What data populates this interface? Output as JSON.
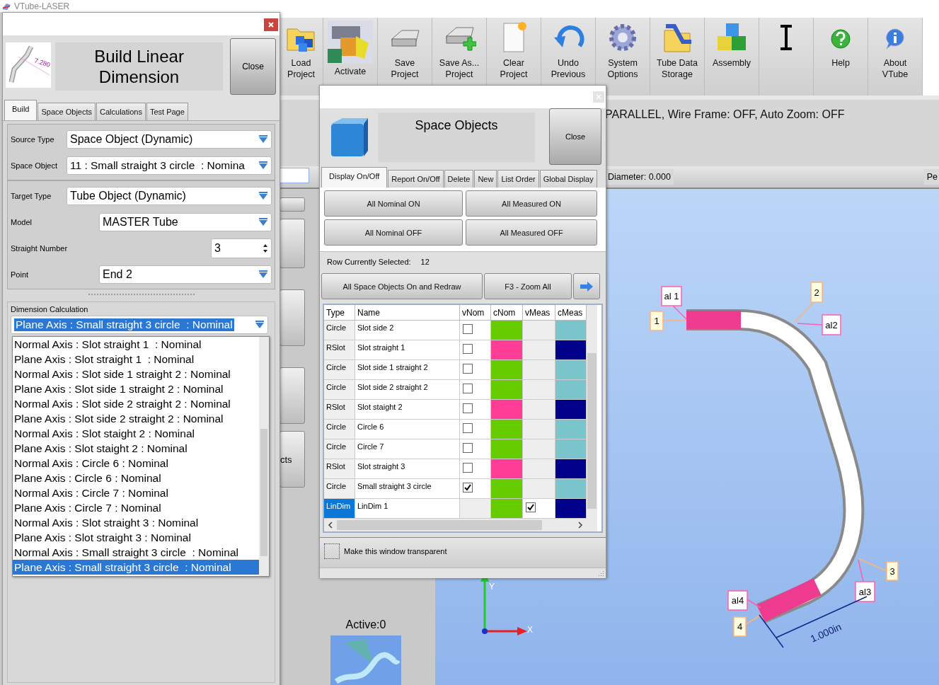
{
  "app": {
    "title": "VTube-LASER"
  },
  "toolbar": [
    {
      "kind": "load",
      "label": "Load Project"
    },
    {
      "kind": "activate",
      "label": "Activate"
    },
    {
      "kind": "save",
      "label": "Save Project"
    },
    {
      "kind": "save_as",
      "label": "Save As... Project"
    },
    {
      "kind": "clear",
      "label": "Clear Project"
    },
    {
      "kind": "undo",
      "label": "Undo Previous"
    },
    {
      "kind": "options",
      "label": "System Options"
    },
    {
      "kind": "storage",
      "label": "Tube Data Storage"
    },
    {
      "kind": "assembly",
      "label": "Assembly"
    },
    {
      "kind": "cursor"
    },
    {
      "kind": "help",
      "label": "Help"
    },
    {
      "kind": "about",
      "label": "About VTube"
    }
  ],
  "status": {
    "view_info": "PARALLEL, Wire Frame: OFF, Auto Zoom: OFF",
    "diameter": "Diameter: 0.000",
    "column_2": "Pe"
  },
  "side_panel": {
    "button_text": "cts",
    "active": "Active:0"
  },
  "viewport": {
    "axis_x": "X",
    "axis_y": "Y",
    "dimension": "1.000in",
    "callouts": [
      {
        "text": "al 1",
        "kind": "alignment"
      },
      {
        "text": "1",
        "kind": "point"
      },
      {
        "text": "2",
        "kind": "point"
      },
      {
        "text": "al2",
        "kind": "alignment"
      },
      {
        "text": "3",
        "kind": "point"
      },
      {
        "text": "al3",
        "kind": "alignment"
      },
      {
        "text": "al4",
        "kind": "alignment"
      },
      {
        "text": "4",
        "kind": "point"
      }
    ]
  },
  "build_dialog": {
    "title": "Build Linear Dimension",
    "icon_text": "7.280",
    "close": "Close",
    "tabs": [
      {
        "label": "Build",
        "selected": true
      },
      {
        "label": "Space Objects",
        "selected": false
      },
      {
        "label": "Calculations",
        "selected": false
      },
      {
        "label": "Test Page",
        "selected": false
      }
    ],
    "source_group": [
      {
        "label": "Source Type",
        "value": "Space Object (Dynamic)",
        "kind": "combo"
      },
      {
        "label": "Space Object",
        "value": "11 : Small straight 3 circle  : Nomina",
        "kind": "combo"
      }
    ],
    "target_group": [
      {
        "label": "Target Type",
        "value": "Tube Object (Dynamic)",
        "kind": "combo"
      },
      {
        "label": "Model",
        "value": "MASTER Tube",
        "kind": "combo"
      },
      {
        "label": "Straight Number",
        "value": "3",
        "kind": "spin"
      },
      {
        "label": "Point",
        "value": "End 2",
        "kind": "combo"
      }
    ],
    "dimension_calculation": {
      "label": "Dimension Calculation",
      "value": "Plane Axis : Small straight 3 circle  : Nominal",
      "options": [
        {
          "text": "Normal Axis : Slot straight 1  : Nominal",
          "selected": false
        },
        {
          "text": "Plane Axis : Slot straight 1  : Nominal",
          "selected": false
        },
        {
          "text": "Normal Axis : Slot side 1 straight 2 : Nominal",
          "selected": false
        },
        {
          "text": "Plane Axis : Slot side 1 straight 2 : Nominal",
          "selected": false
        },
        {
          "text": "Normal Axis : Slot side 2 straight 2 : Nominal",
          "selected": false
        },
        {
          "text": "Plane Axis : Slot side 2 straight 2 : Nominal",
          "selected": false
        },
        {
          "text": "Normal Axis : Slot staight 2 : Nominal",
          "selected": false
        },
        {
          "text": "Plane Axis : Slot staight 2 : Nominal",
          "selected": false
        },
        {
          "text": "Normal Axis : Circle 6 : Nominal",
          "selected": false
        },
        {
          "text": "Plane Axis : Circle 6 : Nominal",
          "selected": false
        },
        {
          "text": "Normal Axis : Circle 7 : Nominal",
          "selected": false
        },
        {
          "text": "Plane Axis : Circle 7 : Nominal",
          "selected": false
        },
        {
          "text": "Normal Axis : Slot straight 3 : Nominal",
          "selected": false
        },
        {
          "text": "Plane Axis : Slot straight 3 : Nominal",
          "selected": false
        },
        {
          "text": "Normal Axis : Small straight 3 circle  : Nominal",
          "selected": false
        },
        {
          "text": "Plane Axis : Small straight 3 circle  : Nominal",
          "selected": true
        }
      ]
    }
  },
  "space_objects": {
    "title": "Space Objects",
    "close": "Close",
    "tabs": [
      {
        "label": "Display On/Off",
        "selected": true
      },
      {
        "label": "Report On/Off",
        "selected": false
      },
      {
        "label": "Delete",
        "selected": false
      },
      {
        "label": "New",
        "selected": false
      },
      {
        "label": "List Order",
        "selected": false
      },
      {
        "label": "Global Display",
        "selected": false
      }
    ],
    "buttons": [
      "All Nominal ON",
      "All Measured ON",
      "All Nominal OFF",
      "All Measured OFF"
    ],
    "row_selected_label": "Row Currently Selected:",
    "row_selected_value": "12",
    "actions": [
      "All Space Objects On and Redraw",
      "F3 - Zoom All"
    ],
    "columns": [
      "Type",
      "Name",
      "vNom",
      "cNom",
      "vMeas",
      "cMeas"
    ],
    "rows": [
      {
        "type": "Circle",
        "name": "Slot side 2",
        "vnom": false,
        "cnom": {
          "color": "#66cc00"
        },
        "cmeas": {
          "color": "#7ac4cc"
        },
        "selected": false
      },
      {
        "type": "RSlot",
        "name": "Slot straight 1",
        "vnom": false,
        "cnom": {
          "color": "#ff3d96"
        },
        "cmeas": {
          "color": "#00008b"
        },
        "selected": false
      },
      {
        "type": "Circle",
        "name": "Slot side 1 straight 2",
        "vnom": false,
        "cnom": {
          "color": "#66cc00"
        },
        "cmeas": {
          "color": "#7ac4cc"
        },
        "selected": false
      },
      {
        "type": "Circle",
        "name": "Slot side 2 straight 2",
        "vnom": false,
        "cnom": {
          "color": "#66cc00"
        },
        "cmeas": {
          "color": "#7ac4cc"
        },
        "selected": false
      },
      {
        "type": "RSlot",
        "name": "Slot staight 2",
        "vnom": false,
        "cnom": {
          "color": "#ff3d96"
        },
        "cmeas": {
          "color": "#00008b"
        },
        "selected": false
      },
      {
        "type": "Circle",
        "name": "Circle 6",
        "vnom": false,
        "cnom": {
          "color": "#66cc00"
        },
        "cmeas": {
          "color": "#7ac4cc"
        },
        "selected": false
      },
      {
        "type": "Circle",
        "name": "Circle 7",
        "vnom": false,
        "cnom": {
          "color": "#66cc00"
        },
        "cmeas": {
          "color": "#7ac4cc"
        },
        "selected": false
      },
      {
        "type": "RSlot",
        "name": "Slot straight 3",
        "vnom": false,
        "cnom": {
          "color": "#ff3d96"
        },
        "cmeas": {
          "color": "#00008b"
        },
        "selected": false
      },
      {
        "type": "Circle",
        "name": "Small straight 3 circle",
        "vnom": true,
        "cnom": {
          "color": "#66cc00"
        },
        "cmeas": {
          "color": "#7ac4cc"
        },
        "selected": false
      },
      {
        "type": "LinDim",
        "name": "LinDim 1",
        "vmeas": true,
        "cnom": {
          "color": "#66cc00"
        },
        "cmeas": {
          "color": "#00008b"
        },
        "selected": true
      }
    ],
    "transparent": {
      "label": "Make this window transparent",
      "checked": false
    }
  }
}
